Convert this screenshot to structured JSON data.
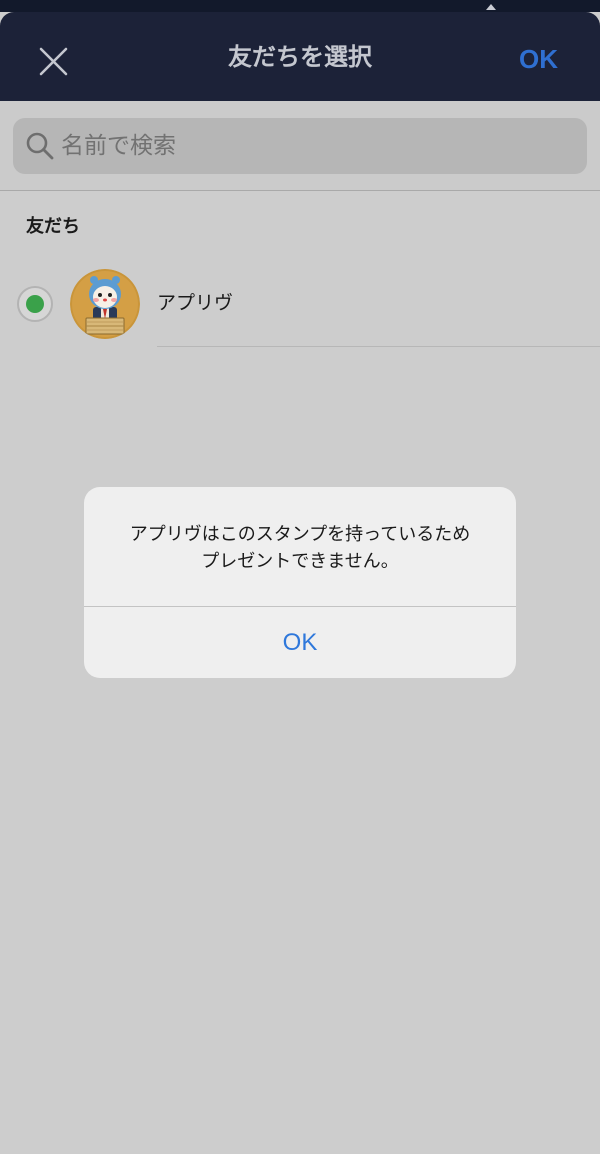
{
  "header": {
    "title": "友だちを選択",
    "confirm_label": "OK",
    "close_icon": "close-icon"
  },
  "search": {
    "placeholder": "名前で検索",
    "icon": "search-icon"
  },
  "friends_section": {
    "header": "友だち",
    "items": [
      {
        "name": "アプリヴ",
        "selected": true,
        "avatar_icon": "mascot-avatar"
      }
    ]
  },
  "alert": {
    "message_line1": "アプリヴはこのスタンプを持っているため",
    "message_line2": "プレゼントできません。",
    "ok_label": "OK"
  },
  "colors": {
    "header_bg": "#1c2238",
    "accent": "#2f6fd0",
    "selected_green": "#3aa14a",
    "overlay_bg": "#cdcdcd"
  }
}
